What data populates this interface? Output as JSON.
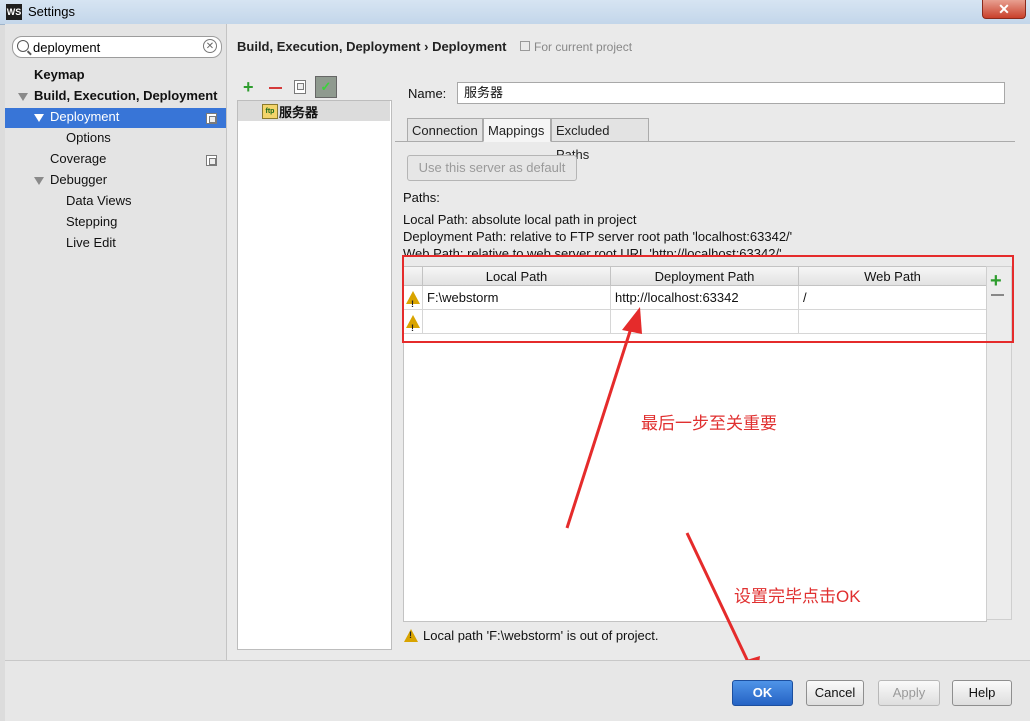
{
  "window": {
    "title": "Settings",
    "app_icon": "WS"
  },
  "search": {
    "value": "deployment"
  },
  "tree": {
    "keymap": "Keymap",
    "build": "Build, Execution, Deployment",
    "deployment": "Deployment",
    "options": "Options",
    "coverage": "Coverage",
    "debugger": "Debugger",
    "data_views": "Data Views",
    "stepping": "Stepping",
    "live_edit": "Live Edit"
  },
  "breadcrumb": {
    "parent": "Build, Execution, Deployment",
    "sep": "›",
    "current": "Deployment",
    "note": "For current project"
  },
  "server": {
    "name": "服务器",
    "icon_text": "ftp"
  },
  "form": {
    "name_label": "Name:",
    "name_value": "服务器"
  },
  "tabs": [
    "Connection",
    "Mappings",
    "Excluded Paths"
  ],
  "mappings": {
    "default_button": "Use this server as default",
    "paths_label": "Paths:",
    "info": [
      "Local Path: absolute local path in project",
      "Deployment Path: relative to FTP server root path 'localhost:63342/'",
      "Web Path: relative to web server root URL 'http://localhost:63342/'"
    ],
    "columns": [
      "Local Path",
      "Deployment Path",
      "Web Path"
    ],
    "rows": [
      [
        "F:\\webstorm",
        "http://localhost:63342",
        "/"
      ],
      [
        "",
        "",
        ""
      ]
    ],
    "status": "Local path 'F:\\webstorm' is out of project."
  },
  "annotations": {
    "step": "最后一步至关重要",
    "ok_hint": "设置完毕点击OK"
  },
  "buttons": {
    "ok": "OK",
    "cancel": "Cancel",
    "apply": "Apply",
    "help": "Help"
  },
  "colors": {
    "selection": "#3875d7",
    "accent_red": "#e52b2b",
    "ok_blue": "#2563c4"
  },
  "icons": {
    "add": "plus-icon",
    "remove": "minus-icon",
    "copy": "copy-icon",
    "check": "check-icon",
    "warning": "warning-icon",
    "search": "search-icon",
    "clear": "clear-icon"
  }
}
